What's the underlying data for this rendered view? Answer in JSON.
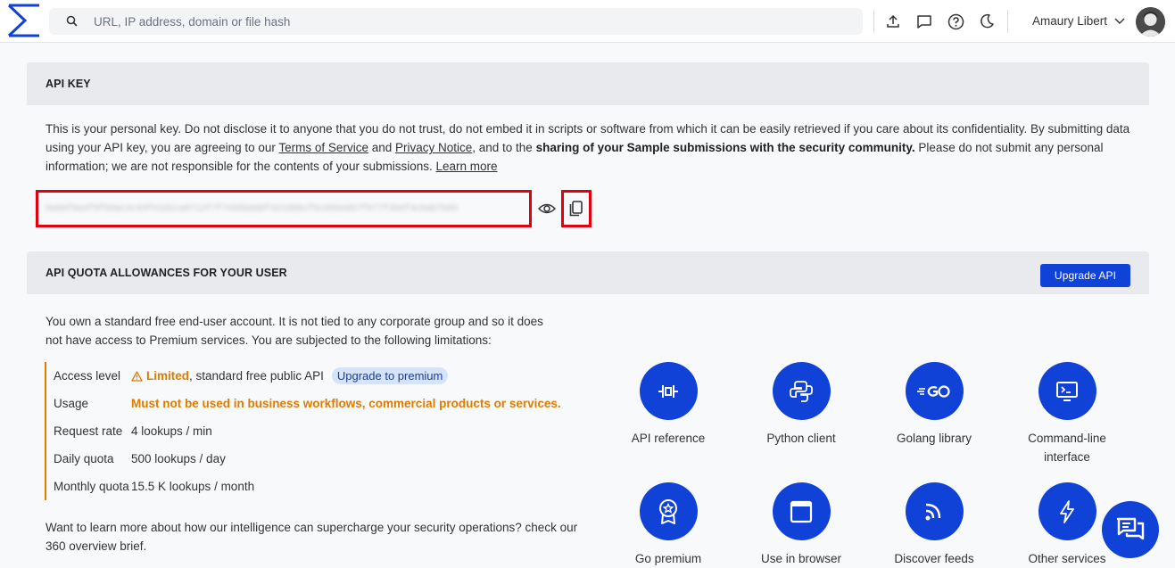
{
  "topbar": {
    "search_placeholder": "URL, IP address, domain or file hash",
    "user_name": "Amaury Libert"
  },
  "api_key": {
    "title": "API KEY",
    "desc_part1": "This is your personal key. Do not disclose it to anyone that you do not trust, do not embed it in scripts or software from which it can be easily retrieved if you care about its confidentiality. By submitting data using your API key, you are agreeing to our ",
    "terms_link": "Terms of Service",
    "and_text": " and ",
    "privacy_link": "Privacy Notice",
    "desc_part2": ", and to the ",
    "desc_bold": "sharing of your Sample submissions with the security community.",
    "desc_part3": " Please do not submit any personal information; we are not responsible for the contents of your submissions. ",
    "learn_more": "Learn more",
    "masked_key": "0a86f8a4f9f59ac4c93fe1d1ca8712f7f7eb5b8d0f4e1d9bcf5c695e6b7f977f2b6f4c0ab7b05"
  },
  "quota": {
    "title": "API QUOTA ALLOWANCES FOR YOUR USER",
    "upgrade_button": "Upgrade API",
    "intro": "You own a standard free end-user account. It is not tied to any corporate group and so it does not have access to Premium services. You are subjected to the following limitations:",
    "rows": [
      {
        "label": "Access level",
        "warn": "Limited",
        "value": ", standard free public API",
        "pill": "Upgrade to premium"
      },
      {
        "label": "Usage",
        "value": "Must not be used in business workflows, commercial products or services."
      },
      {
        "label": "Request rate",
        "value": "4 lookups / min"
      },
      {
        "label": "Daily quota",
        "value": "500 lookups / day"
      },
      {
        "label": "Monthly quota",
        "value": "15.5 K lookups / month"
      }
    ],
    "outro": "Want to learn more about how our intelligence can supercharge your security operations? check our 360 overview brief."
  },
  "tools": [
    {
      "label": "API reference",
      "icon": "api-reference-icon"
    },
    {
      "label": "Python client",
      "icon": "python-icon"
    },
    {
      "label": "Golang library",
      "icon": "golang-icon"
    },
    {
      "label": "Command-line interface",
      "icon": "terminal-icon"
    },
    {
      "label": "Go premium",
      "icon": "badge-icon"
    },
    {
      "label": "Use in browser",
      "icon": "browser-icon"
    },
    {
      "label": "Discover feeds",
      "icon": "rss-icon"
    },
    {
      "label": "Other services",
      "icon": "bolt-icon"
    }
  ],
  "colors": {
    "accent": "#1142d8",
    "warning": "#e07b00",
    "highlight": "#e0000f"
  }
}
